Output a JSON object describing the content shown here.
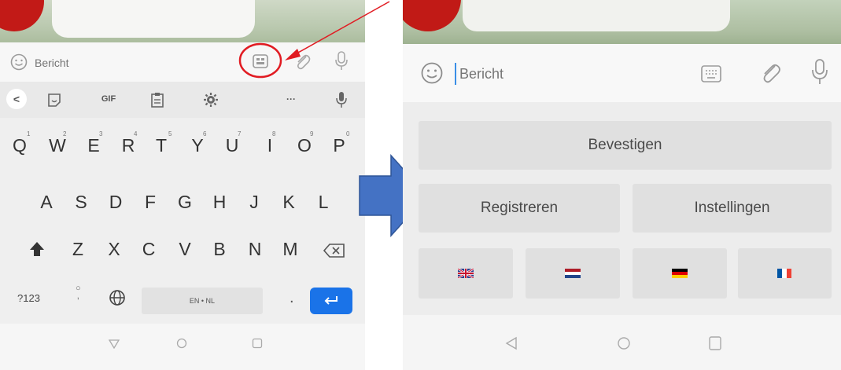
{
  "left_screen": {
    "input": {
      "placeholder": "Bericht"
    },
    "toolbar": {
      "gif_label": "GIF",
      "more_label": "···",
      "back_label": "<"
    },
    "keyboard": {
      "row1": [
        "Q",
        "W",
        "E",
        "R",
        "T",
        "Y",
        "U",
        "I",
        "O",
        "P"
      ],
      "row1_hints": [
        "1",
        "2",
        "3",
        "4",
        "5",
        "6",
        "7",
        "8",
        "9",
        "0"
      ],
      "row2": [
        "A",
        "S",
        "D",
        "F",
        "G",
        "H",
        "J",
        "K",
        "L"
      ],
      "row3": [
        "Z",
        "X",
        "C",
        "V",
        "B",
        "N",
        "M"
      ],
      "symbols_key": "?123",
      "space_label": "EN • NL",
      "period_key": ".",
      "comma_key": ","
    }
  },
  "right_screen": {
    "input": {
      "placeholder": "Bericht"
    },
    "buttons": {
      "confirm": "Bevestigen",
      "register": "Registreren",
      "settings": "Instellingen"
    },
    "flags": [
      "uk-flag",
      "nl-flag",
      "de-flag",
      "fr-flag"
    ]
  },
  "colors": {
    "annotation_red": "#e11b22",
    "arrow_blue": "#4472c4",
    "enter_key_blue": "#1a73e8"
  }
}
